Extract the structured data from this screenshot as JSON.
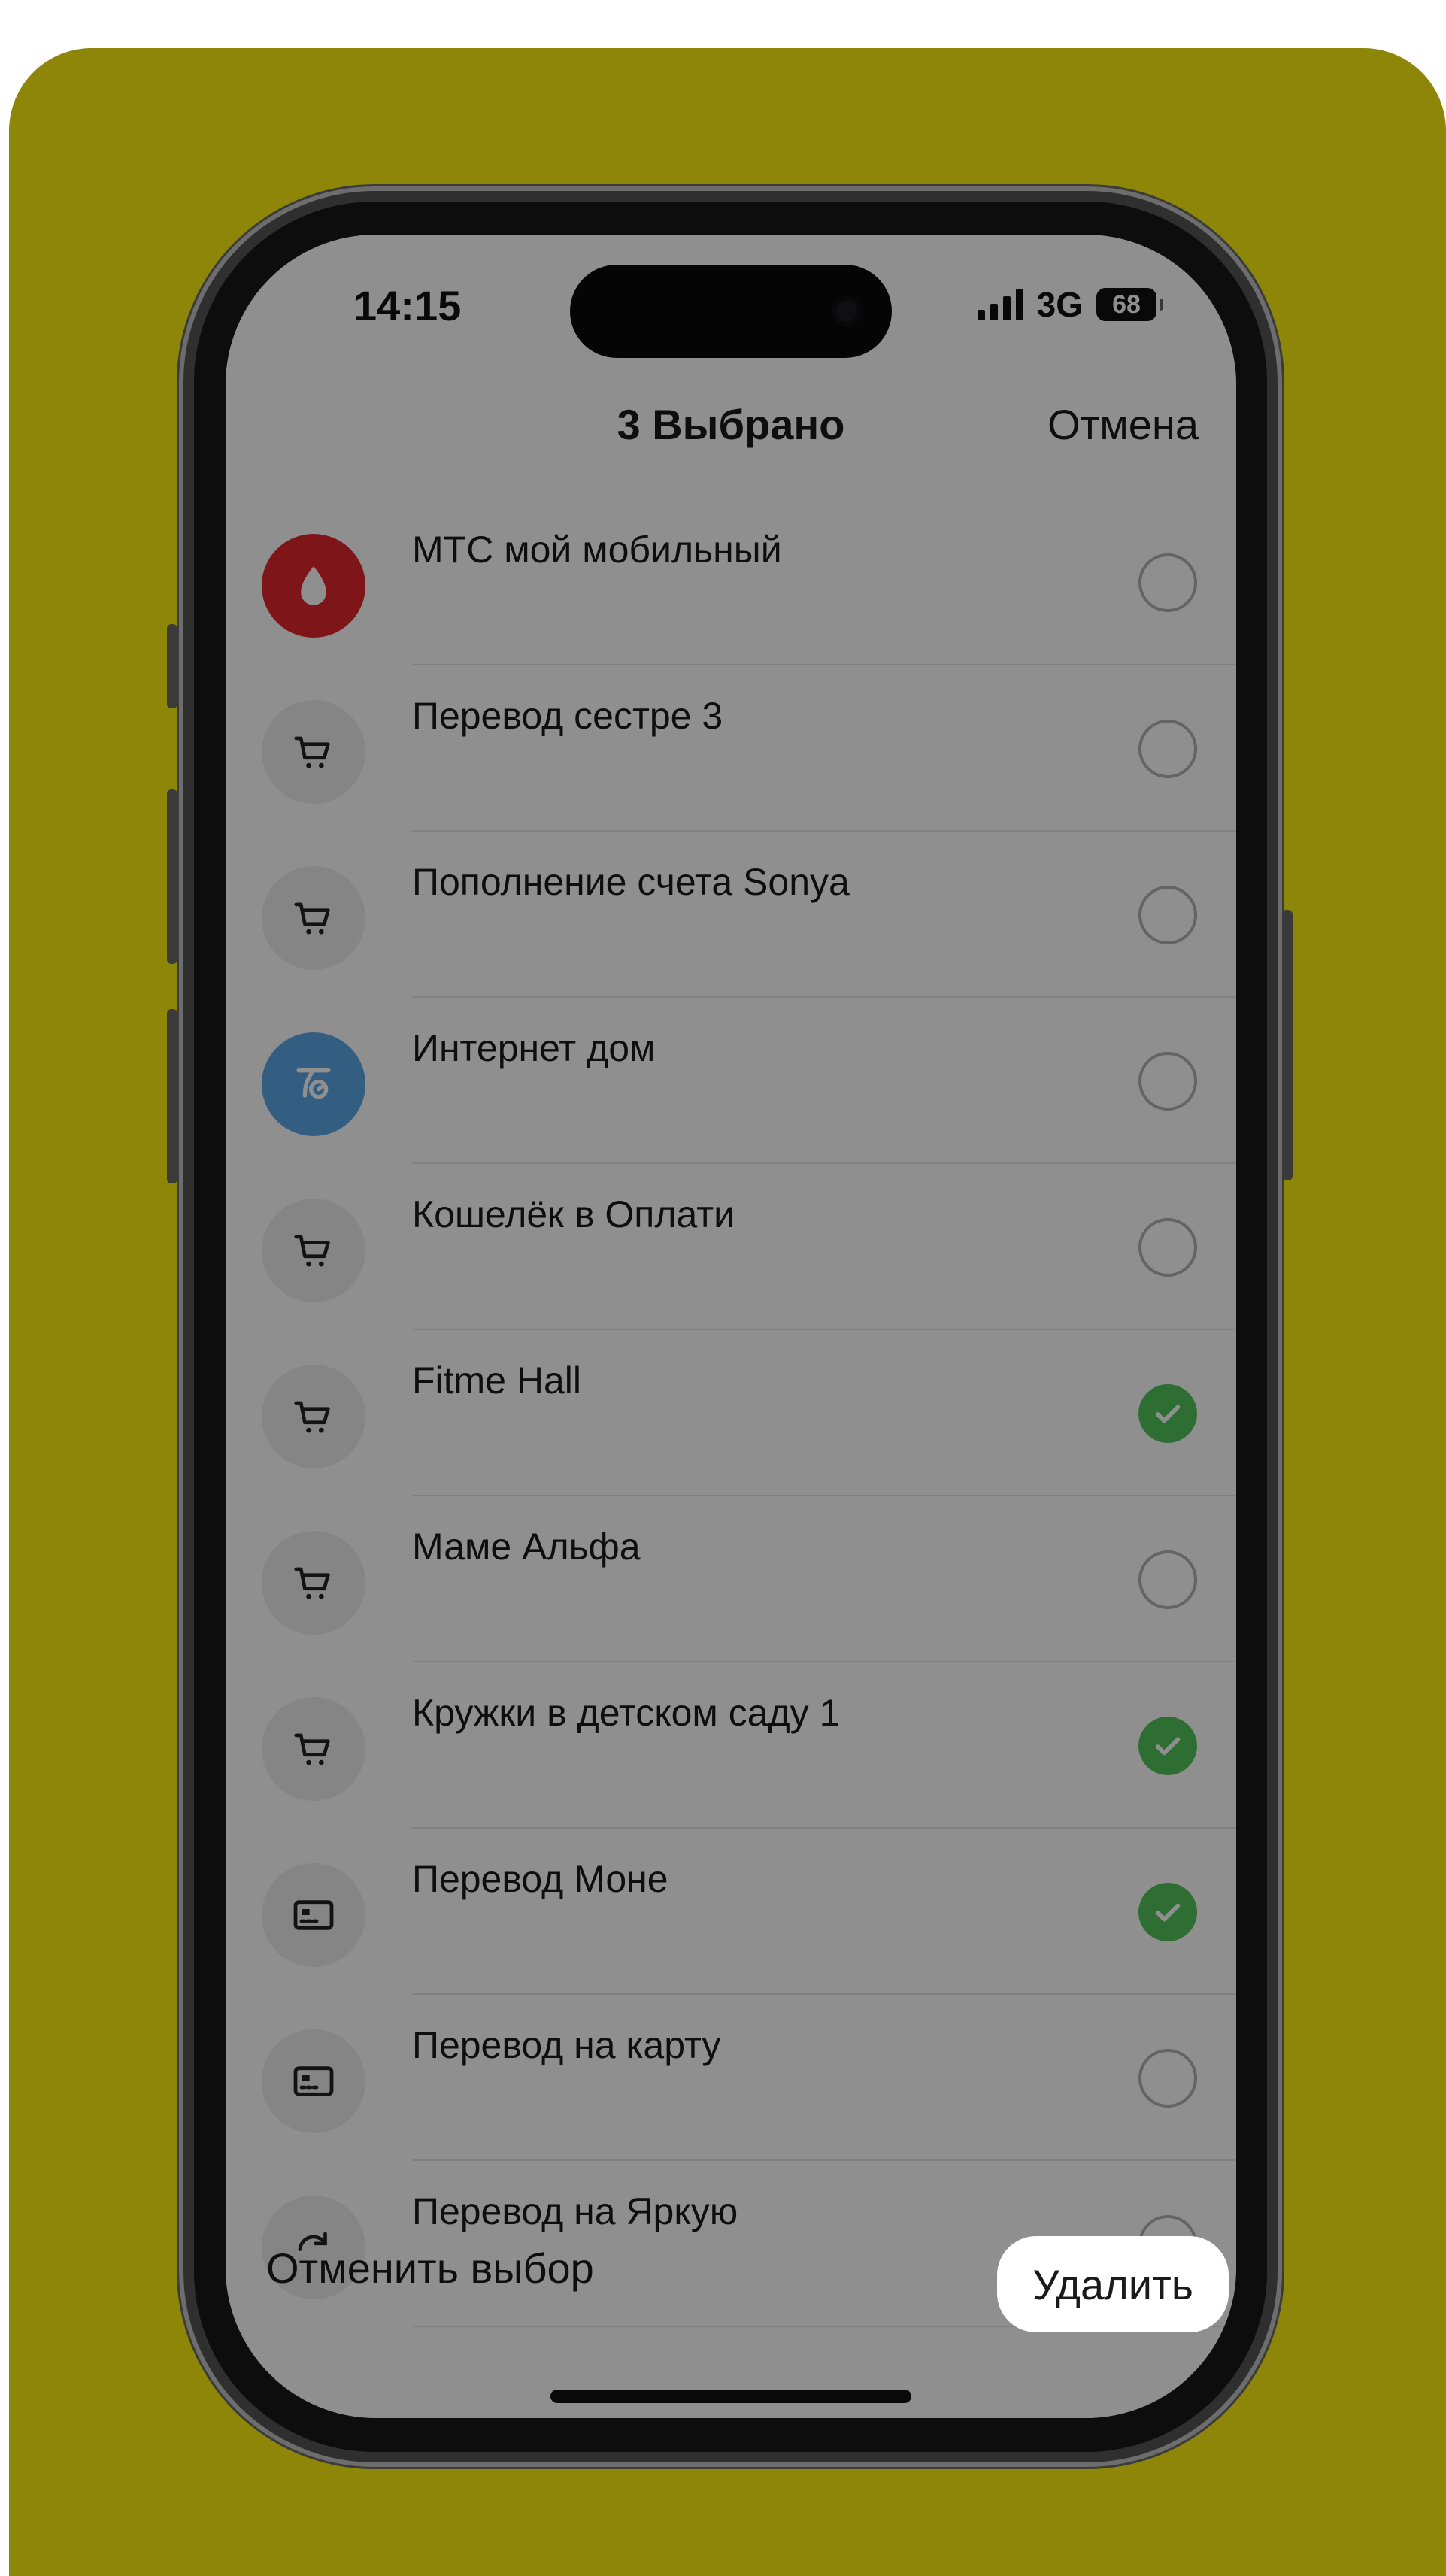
{
  "colors": {
    "backdrop": "#8d8609",
    "check_selected": "#52c55b",
    "mts_brand": "#e0282e",
    "internet_brand": "#5ea7e8"
  },
  "status_bar": {
    "time": "14:15",
    "network": "3G",
    "battery": "68"
  },
  "header": {
    "title": "3 Выбрано",
    "cancel_label": "Отмена"
  },
  "items": [
    {
      "label": "МТС мой мобильный",
      "icon": "mts-egg-icon",
      "selected": false
    },
    {
      "label": "Перевод сестре 3",
      "icon": "cart-icon",
      "selected": false
    },
    {
      "label": "Пополнение счета Sonya",
      "icon": "cart-icon",
      "selected": false
    },
    {
      "label": "Интернет дом",
      "icon": "internet-provider-icon",
      "selected": false
    },
    {
      "label": "Кошелёк в Оплати",
      "icon": "cart-icon",
      "selected": false
    },
    {
      "label": "Fitme Hall",
      "icon": "cart-icon",
      "selected": true
    },
    {
      "label": "Маме Альфа",
      "icon": "cart-icon",
      "selected": false
    },
    {
      "label": "Кружки в детском саду 1",
      "icon": "cart-icon",
      "selected": true
    },
    {
      "label": "Перевод Моне",
      "icon": "card-icon",
      "selected": true
    },
    {
      "label": "Перевод на карту",
      "icon": "card-icon",
      "selected": false
    },
    {
      "label": "Перевод на Яркую",
      "icon": "refresh-icon",
      "selected": false
    }
  ],
  "bottom_bar": {
    "deselect_label": "Отменить выбор",
    "delete_label": "Удалить"
  }
}
